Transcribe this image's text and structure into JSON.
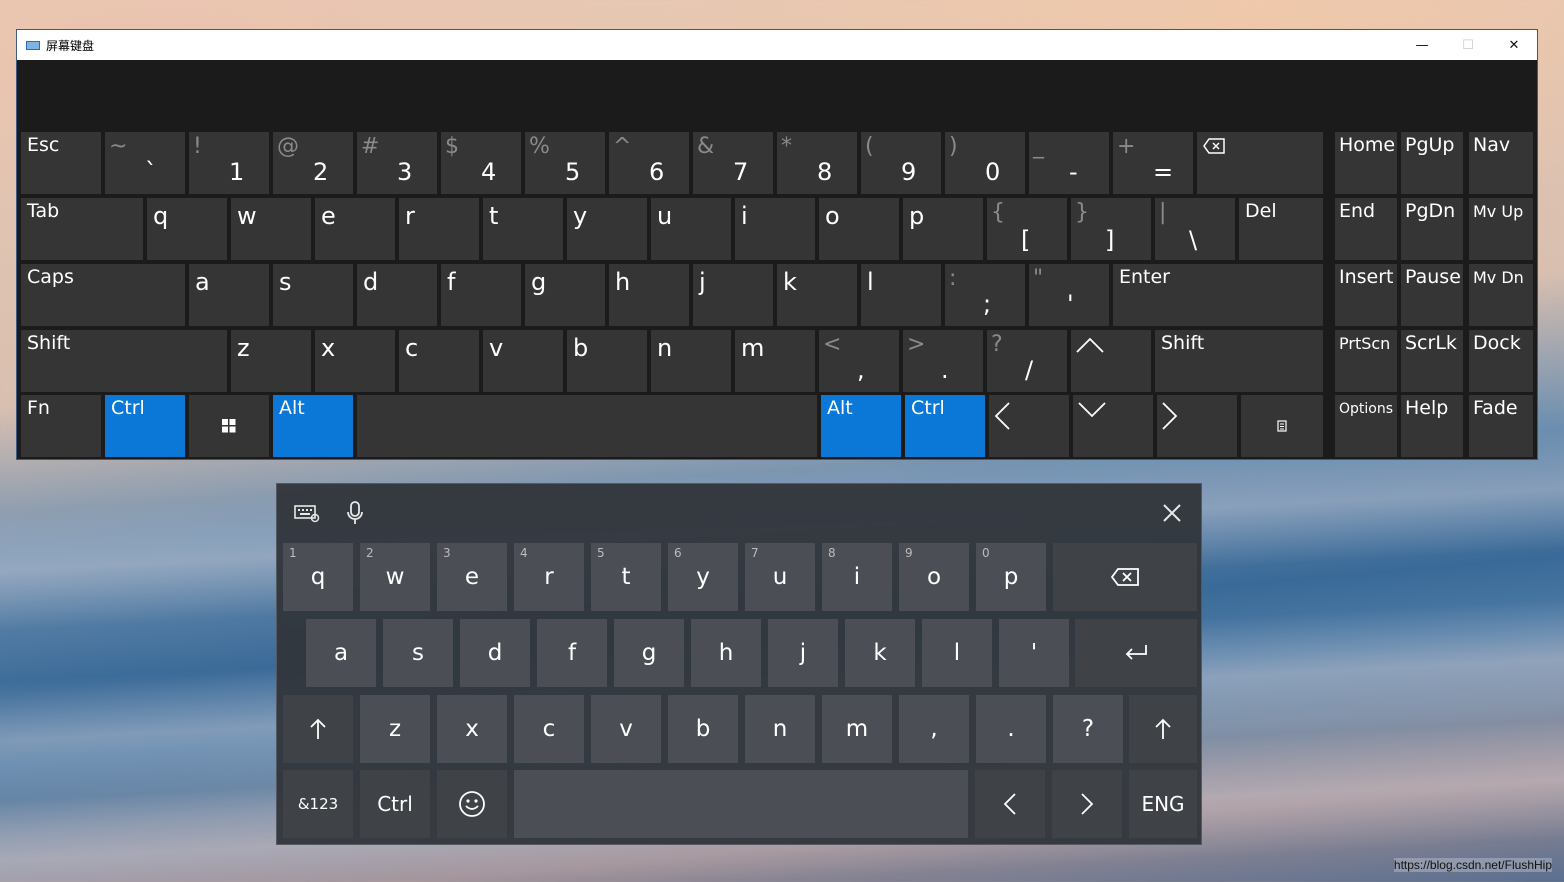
{
  "osk": {
    "title": "屏幕键盘",
    "window_controls": {
      "minimize": "—",
      "maximize": "☐",
      "close": "✕"
    },
    "row1": [
      {
        "name": "esc",
        "label": "Esc"
      },
      {
        "name": "backtick",
        "top": "~",
        "bot": "`"
      },
      {
        "name": "1",
        "top": "!",
        "bot": "1"
      },
      {
        "name": "2",
        "top": "@",
        "bot": "2"
      },
      {
        "name": "3",
        "top": "#",
        "bot": "3"
      },
      {
        "name": "4",
        "top": "$",
        "bot": "4"
      },
      {
        "name": "5",
        "top": "%",
        "bot": "5"
      },
      {
        "name": "6",
        "top": "^",
        "bot": "6"
      },
      {
        "name": "7",
        "top": "&",
        "bot": "7"
      },
      {
        "name": "8",
        "top": "*",
        "bot": "8"
      },
      {
        "name": "9",
        "top": "(",
        "bot": "9"
      },
      {
        "name": "0",
        "top": ")",
        "bot": "0"
      },
      {
        "name": "minus",
        "top": "_",
        "bot": "-"
      },
      {
        "name": "equals",
        "top": "+",
        "bot": "="
      }
    ],
    "row2": [
      "Tab",
      "q",
      "w",
      "e",
      "r",
      "t",
      "y",
      "u",
      "i",
      "o",
      "p"
    ],
    "row2_sym": [
      {
        "name": "lbracket",
        "top": "{",
        "bot": "["
      },
      {
        "name": "rbracket",
        "top": "}",
        "bot": "]"
      },
      {
        "name": "backslash",
        "top": "|",
        "bot": "\\"
      }
    ],
    "del": "Del",
    "row3": [
      "Caps",
      "a",
      "s",
      "d",
      "f",
      "g",
      "h",
      "j",
      "k",
      "l"
    ],
    "row3_sym": [
      {
        "name": "semicolon",
        "top": ":",
        "bot": ";"
      },
      {
        "name": "quote",
        "top": "\"",
        "bot": "'"
      }
    ],
    "enter": "Enter",
    "row4": [
      "Shift",
      "z",
      "x",
      "c",
      "v",
      "b",
      "n",
      "m"
    ],
    "row4_sym": [
      {
        "name": "comma",
        "top": "<",
        "bot": ","
      },
      {
        "name": "period",
        "top": ">",
        "bot": "."
      },
      {
        "name": "slash",
        "top": "?",
        "bot": "/"
      }
    ],
    "shift_right": "Shift",
    "row5": {
      "fn": "Fn",
      "ctrl": "Ctrl",
      "alt": "Alt",
      "alt_r": "Alt",
      "ctrl_r": "Ctrl"
    },
    "nav": {
      "home": "Home",
      "pgup": "PgUp",
      "nav": "Nav",
      "end": "End",
      "pgdn": "PgDn",
      "mvup": "Mv Up",
      "insert": "Insert",
      "pause": "Pause",
      "mvdn": "Mv Dn",
      "prtscn": "PrtScn",
      "scrlk": "ScrLk",
      "dock": "Dock",
      "options": "Options",
      "help": "Help",
      "fade": "Fade"
    },
    "colors": {
      "accent": "#0b78d7",
      "key": "#353535",
      "bg": "#1b1b1b"
    }
  },
  "touch": {
    "row1": [
      {
        "k": "q",
        "h": "1"
      },
      {
        "k": "w",
        "h": "2"
      },
      {
        "k": "e",
        "h": "3"
      },
      {
        "k": "r",
        "h": "4"
      },
      {
        "k": "t",
        "h": "5"
      },
      {
        "k": "y",
        "h": "6"
      },
      {
        "k": "u",
        "h": "7"
      },
      {
        "k": "i",
        "h": "8"
      },
      {
        "k": "o",
        "h": "9"
      },
      {
        "k": "p",
        "h": "0"
      }
    ],
    "row2": [
      "a",
      "s",
      "d",
      "f",
      "g",
      "h",
      "j",
      "k",
      "l",
      "'"
    ],
    "row3": [
      "z",
      "x",
      "c",
      "v",
      "b",
      "n",
      "m",
      ",",
      ".",
      "?"
    ],
    "row4": {
      "sym": "&123",
      "ctrl": "Ctrl",
      "lang": "ENG"
    }
  },
  "watermark": "https://blog.csdn.net/FlushHip"
}
